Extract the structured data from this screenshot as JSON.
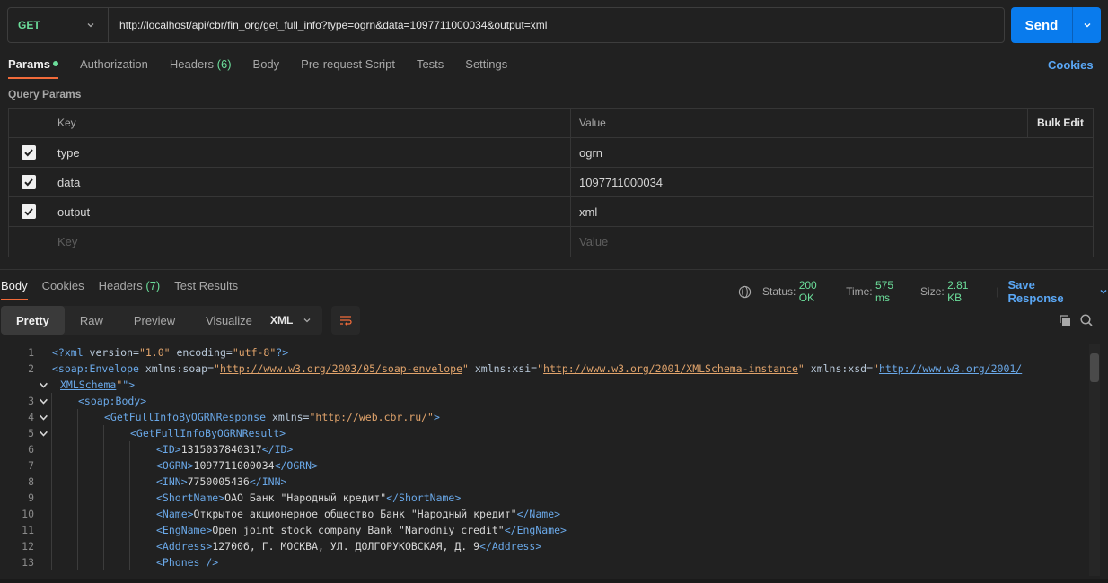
{
  "request": {
    "method": "GET",
    "url": "http://localhost/api/cbr/fin_org/get_full_info?type=ogrn&data=1097711000034&output=xml",
    "send_label": "Send"
  },
  "req_tabs": [
    {
      "label": "Params"
    },
    {
      "label": "Authorization"
    },
    {
      "label": "Headers",
      "count": "(6)"
    },
    {
      "label": "Body"
    },
    {
      "label": "Pre-request Script"
    },
    {
      "label": "Tests"
    },
    {
      "label": "Settings"
    }
  ],
  "cookies_label": "Cookies",
  "query_params": {
    "title": "Query Params",
    "headers": {
      "key": "Key",
      "value": "Value",
      "bulk": "Bulk Edit"
    },
    "rows": [
      {
        "key": "type",
        "value": "ogrn"
      },
      {
        "key": "data",
        "value": "1097711000034"
      },
      {
        "key": "output",
        "value": "xml"
      }
    ],
    "placeholder": {
      "key": "Key",
      "value": "Value"
    }
  },
  "response": {
    "tabs": [
      {
        "label": "Body"
      },
      {
        "label": "Cookies"
      },
      {
        "label": "Headers",
        "count": "(7)"
      },
      {
        "label": "Test Results"
      }
    ],
    "status_label": "Status:",
    "status": "200 OK",
    "time_label": "Time:",
    "time": "575 ms",
    "size_label": "Size:",
    "size": "2.81 KB",
    "save_label": "Save Response",
    "views": [
      "Pretty",
      "Raw",
      "Preview",
      "Visualize"
    ],
    "format": "XML"
  },
  "code": {
    "l1": {
      "n": "1",
      "decl": "<?xml",
      "a1": " version=",
      "v1": "\"1.0\"",
      "a2": " encoding=",
      "v2": "\"utf-8\"",
      "end": "?>"
    },
    "l2": {
      "n": "2",
      "t": "<soap:Envelope",
      "a1": " xmlns:soap=",
      "q": "\"",
      "u1": "http://www.w3.org/2003/05/soap-envelope",
      "a2": " xmlns:xsi=",
      "u2": "http://www.w3.org/2001/XMLSchema-instance",
      "a3": " xmlns:xsd=",
      "u3": "http://www.w3.org/2001/",
      "u3b": "XMLSchema",
      "close": "\">"
    },
    "l3": {
      "n": "3",
      "t": "<soap:Body>"
    },
    "l4": {
      "n": "4",
      "t": "<GetFullInfoByOGRNResponse",
      "a": " xmlns=",
      "u": "http://web.cbr.ru/",
      "close": ">"
    },
    "l5": {
      "n": "5",
      "t": "<GetFullInfoByOGRNResult>"
    },
    "l6": {
      "n": "6",
      "o": "<ID>",
      "v": "1315037840317",
      "c": "</ID>"
    },
    "l7": {
      "n": "7",
      "o": "<OGRN>",
      "v": "1097711000034",
      "c": "</OGRN>"
    },
    "l8": {
      "n": "8",
      "o": "<INN>",
      "v": "7750005436",
      "c": "</INN>"
    },
    "l9": {
      "n": "9",
      "o": "<ShortName>",
      "v": "ОАО Банк \"Народный кредит\"",
      "c": "</ShortName>"
    },
    "l10": {
      "n": "10",
      "o": "<Name>",
      "v": "Открытое акционерное общество Банк \"Народный кредит\"",
      "c": "</Name>"
    },
    "l11": {
      "n": "11",
      "o": "<EngName>",
      "v": "Open joint stock company Bank \"Narodniy credit\"",
      "c": "</EngName>"
    },
    "l12": {
      "n": "12",
      "o": "<Address>",
      "v": "127006, Г. МОСКВА, УЛ. ДОЛГОРУКОВСКАЯ, Д. 9",
      "c": "</Address>"
    },
    "l13": {
      "n": "13",
      "o": "<Phones />"
    }
  }
}
